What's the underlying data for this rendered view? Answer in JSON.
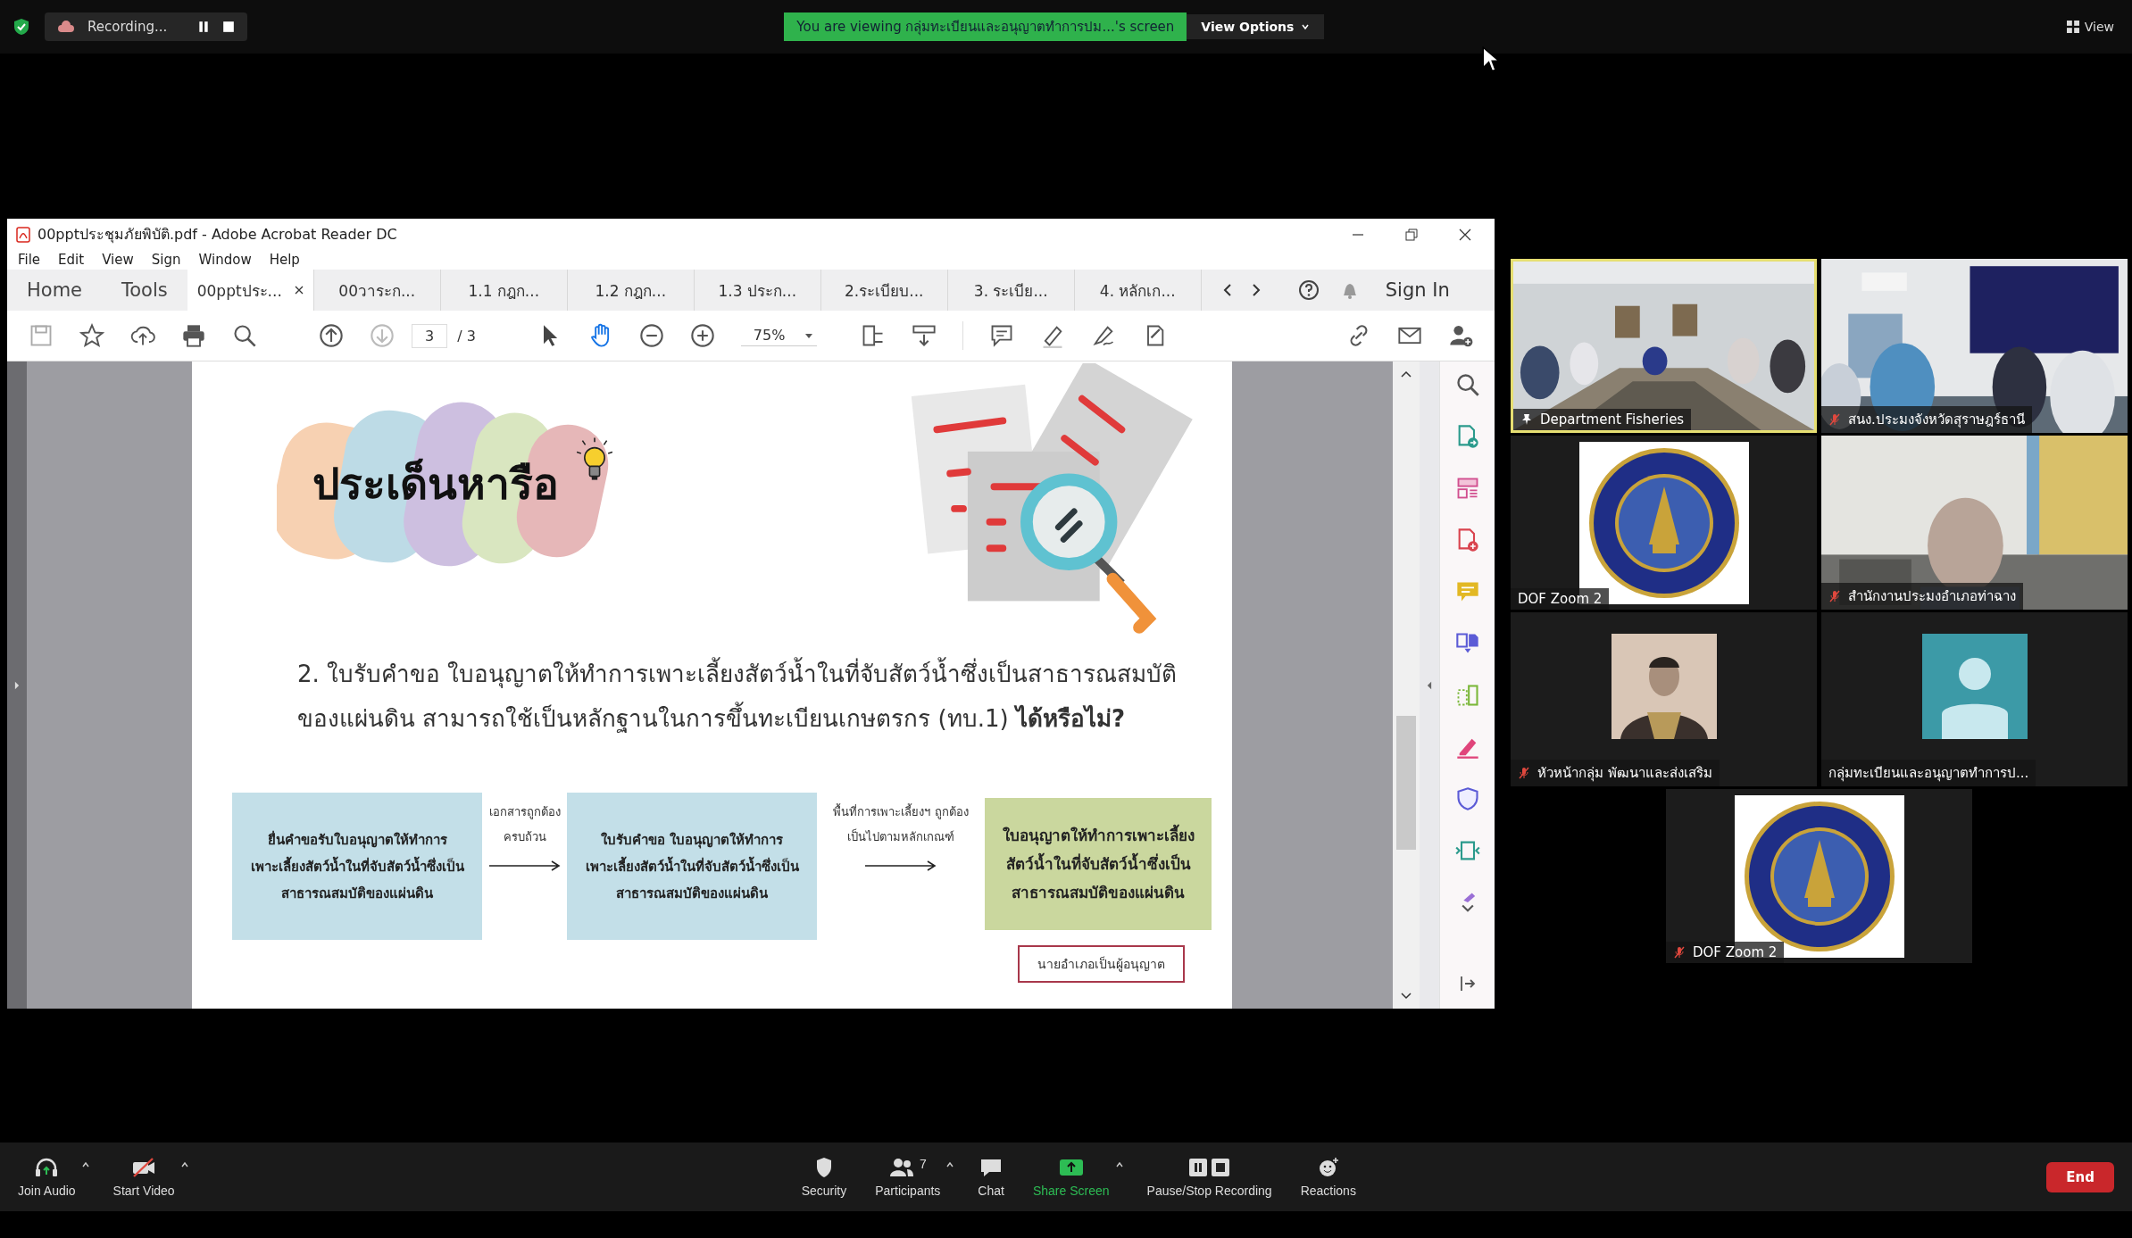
{
  "top_bar": {
    "recording_label": "Recording...",
    "sharing_banner": "You are viewing กลุ่มทะเบียนและอนุญาตทำการปม...'s screen",
    "view_options": "View Options",
    "view_button": "View"
  },
  "acrobat": {
    "title": "00pptประชุมภัยพิบัติ.pdf - Adobe Acrobat Reader DC",
    "menu": [
      "File",
      "Edit",
      "View",
      "Sign",
      "Window",
      "Help"
    ],
    "nav": [
      "Home",
      "Tools"
    ],
    "tabs": [
      {
        "label": "00pptประ...",
        "selected": true
      },
      {
        "label": "00วาระก...",
        "selected": false
      },
      {
        "label": "1.1 กฎก...",
        "selected": false
      },
      {
        "label": "1.2 กฎก...",
        "selected": false
      },
      {
        "label": "1.3 ประก...",
        "selected": false
      },
      {
        "label": "2.ระเบียบ...",
        "selected": false
      },
      {
        "label": "3. ระเบีย...",
        "selected": false
      },
      {
        "label": "4. หลักเก...",
        "selected": false
      }
    ],
    "sign_in": "Sign In",
    "page_number": "3",
    "page_total": "/ 3",
    "zoom_level": "75%"
  },
  "slide": {
    "heading": "ประเด็นหารือ",
    "question_lines": [
      "2. ใบรับคำขอ ใบอนุญาตให้ทำการเพาะเลี้ยงสัตว์น้ำในที่จับสัตว์น้ำซึ่งเป็นสาธารณสมบัติ",
      "ของแผ่นดิน สามารถใช้เป็นหลักฐานในการขึ้นทะเบียนเกษตรกร (ทบ.1) **ได้หรือไม่?**"
    ],
    "flow": [
      {
        "kind": "step",
        "color": "#c3dfe8",
        "lines": [
          "ยื่นคำขอรับใบอนุญาตให้ทำการ",
          "เพาะเลี้ยงสัตว์น้ำในที่จับสัตว์น้ำซึ่งเป็น",
          "สาธารณสมบัติของแผ่นดิน"
        ]
      },
      {
        "kind": "arrow",
        "lines": [
          "เอกสารถูกต้อง",
          "ครบถ้วน"
        ]
      },
      {
        "kind": "step",
        "color": "#c3dfe8",
        "lines": [
          "ใบรับคำขอ ใบอนุญาตให้ทำการ",
          "เพาะเลี้ยงสัตว์น้ำในที่จับสัตว์น้ำซึ่งเป็น",
          "สาธารณสมบัติของแผ่นดิน"
        ]
      },
      {
        "kind": "arrow",
        "lines": [
          "พื้นที่การเพาะเลี้ยงฯ ถูกต้อง",
          "เป็นไปตามหลักเกณฑ์"
        ]
      },
      {
        "kind": "result",
        "color": "#cad79e",
        "lines": [
          "ใบอนุญาตให้ทำการเพาะเลี้ยง",
          "สัตว์น้ำในที่จับสัตว์น้ำซึ่งเป็น",
          "สาธารณสมบัติของแผ่นดิน"
        ]
      }
    ],
    "note": "นายอำเภอเป็นผู้อนุญาต"
  },
  "tiles": [
    {
      "name": "Department Fisheries",
      "kind": "room",
      "speaking": true,
      "pinned": true,
      "muted": false
    },
    {
      "name": "สนง.ประมงจังหวัดสุราษฎร์ธานี",
      "kind": "office",
      "speaking": false,
      "pinned": false,
      "muted": true
    },
    {
      "name": "DOF Zoom 2",
      "kind": "logo",
      "speaking": false,
      "pinned": false,
      "muted": false
    },
    {
      "name": "สำนักงานประมงอำเภอท่าฉาง",
      "kind": "person",
      "speaking": false,
      "pinned": false,
      "muted": true
    },
    {
      "name": "หัวหน้ากลุ่ม พัฒนาและส่งเสริม",
      "kind": "portrait",
      "speaking": false,
      "pinned": false,
      "muted": true
    },
    {
      "name": "กลุ่มทะเบียนและอนุญาตทำการป...",
      "kind": "avatar",
      "speaking": false,
      "pinned": false,
      "muted": false
    },
    {
      "name": "DOF Zoom 2",
      "kind": "logo",
      "speaking": false,
      "pinned": false,
      "muted": true
    }
  ],
  "controls": [
    {
      "kind": "audio",
      "label": "Join Audio",
      "menu": true
    },
    {
      "kind": "video_off",
      "label": "Start Video",
      "menu": true
    },
    {
      "kind": "security",
      "label": "Security",
      "menu": false
    },
    {
      "kind": "participants",
      "label": "Participants",
      "count": "7",
      "menu": true
    },
    {
      "kind": "chat",
      "label": "Chat",
      "menu": false
    },
    {
      "kind": "share",
      "label": "Share Screen",
      "menu": true
    },
    {
      "kind": "recording",
      "label": "Pause/Stop Recording",
      "menu": false
    },
    {
      "kind": "reactions",
      "label": "Reactions",
      "menu": false
    }
  ],
  "end_button": "End"
}
